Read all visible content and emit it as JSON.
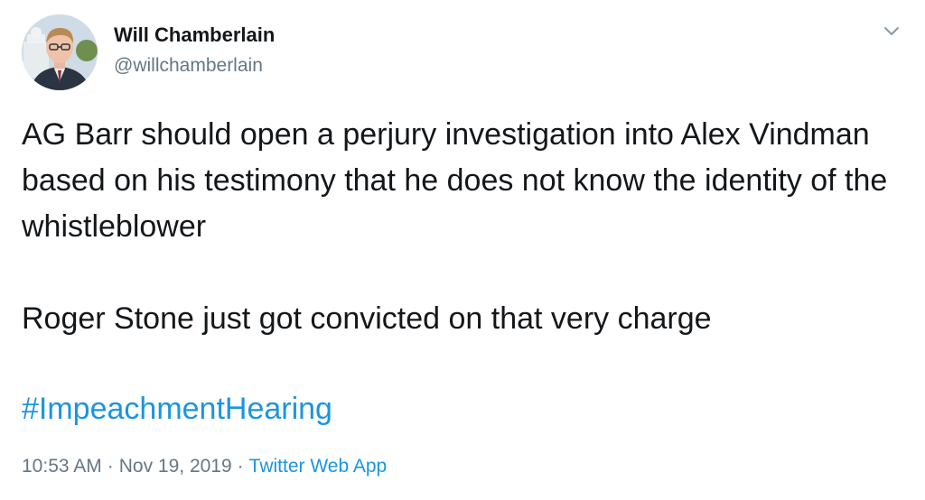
{
  "author": {
    "name": "Will Chamberlain",
    "handle": "@willchamberlain"
  },
  "tweet": {
    "paragraph1": "AG Barr should open a perjury investigation into Alex Vindman based on his testimony that he does not know the identity of the whistleblower",
    "paragraph2": "Roger Stone just got convicted on that very charge",
    "hashtag": "#ImpeachmentHearing"
  },
  "meta": {
    "time": "10:53 AM",
    "separator": "·",
    "date": "Nov 19, 2019",
    "source": "Twitter Web App"
  },
  "icons": {
    "menu": "chevron-down-icon",
    "avatar": "avatar"
  },
  "colors": {
    "link": "#1b95e0",
    "secondary_text": "#657786",
    "primary_text": "#14171a"
  }
}
